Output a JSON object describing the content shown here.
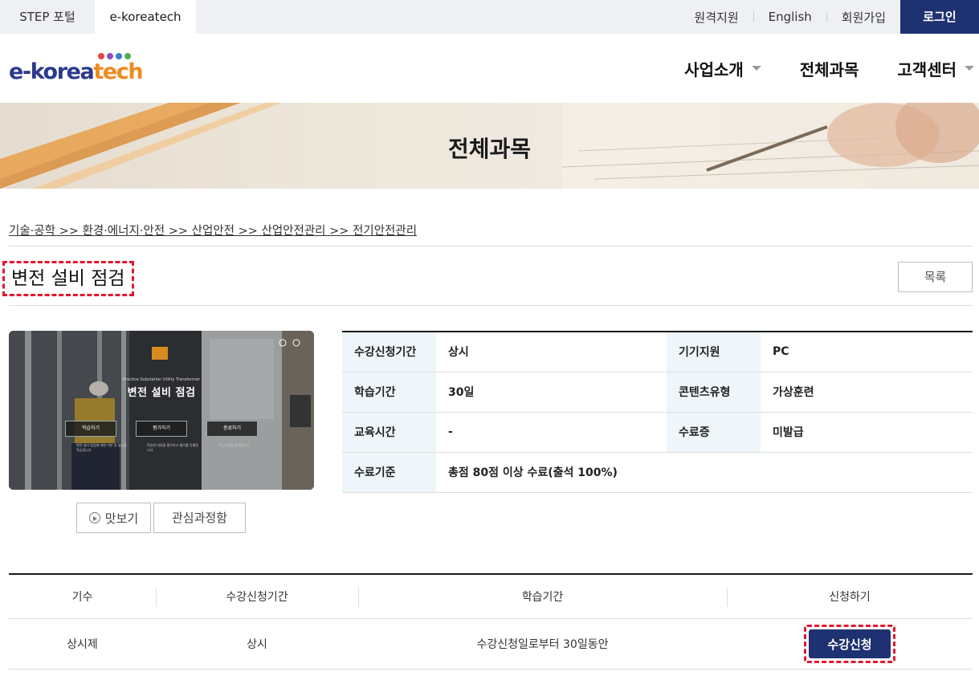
{
  "topbar": {
    "portal_tabs": [
      "STEP 포털",
      "e-koreatech"
    ],
    "util_links": [
      "원격지원",
      "English",
      "회원가입"
    ],
    "login": "로그인"
  },
  "header": {
    "logo_main": "e-korea",
    "logo_accent": "tech",
    "logo_dot_colors": [
      "#e8453c",
      "#8a4fb8",
      "#3d7ec9",
      "#4cb05a"
    ],
    "nav": [
      "사업소개",
      "전체과목",
      "고객센터"
    ]
  },
  "banner": {
    "title": "전체과목"
  },
  "breadcrumb": "기술·공학 >> 환경·에너지·안전 >> 산업안전 >> 산업안전관리 >> 전기안전관리",
  "course": {
    "title": "변전 설비 점검",
    "list_button": "목록",
    "thumbnail": {
      "small_caption": "Practice  Substation  Utility  Transformer",
      "title": "변전 설비 점검",
      "buttons": [
        "학습하기",
        "평가하기",
        "종료하기"
      ],
      "descriptions": [
        "변전 설비 점검에 대한 기본 및 실습을 학습합니다",
        "학습한 내용을 평가하고 평가를 진행합니다",
        "학습 과정을 종료합니다"
      ]
    },
    "preview_button": "맛보기",
    "favorite_button": "관심과정함"
  },
  "info": {
    "rows": [
      {
        "l1": "수강신청기간",
        "v1": "상시",
        "l2": "기기지원",
        "v2": "PC"
      },
      {
        "l1": "학습기간",
        "v1": "30일",
        "l2": "콘텐츠유형",
        "v2": "가상훈련"
      },
      {
        "l1": "교육시간",
        "v1": "-",
        "l2": "수료증",
        "v2": "미발급"
      },
      {
        "l1": "수료기준",
        "v1": "총점 80점 이상 수료(출석 100%)",
        "l2": "",
        "v2": ""
      }
    ]
  },
  "schedule": {
    "headers": [
      "기수",
      "수강신청기간",
      "학습기간",
      "신청하기"
    ],
    "row": {
      "term": "상시제",
      "period": "상시",
      "duration": "수강신청일로부터 30일동안",
      "apply": "수강신청"
    }
  },
  "colors": {
    "navy": "#1e3170",
    "highlight": "#e0182e",
    "table_header_bg": "#eef6fa"
  }
}
